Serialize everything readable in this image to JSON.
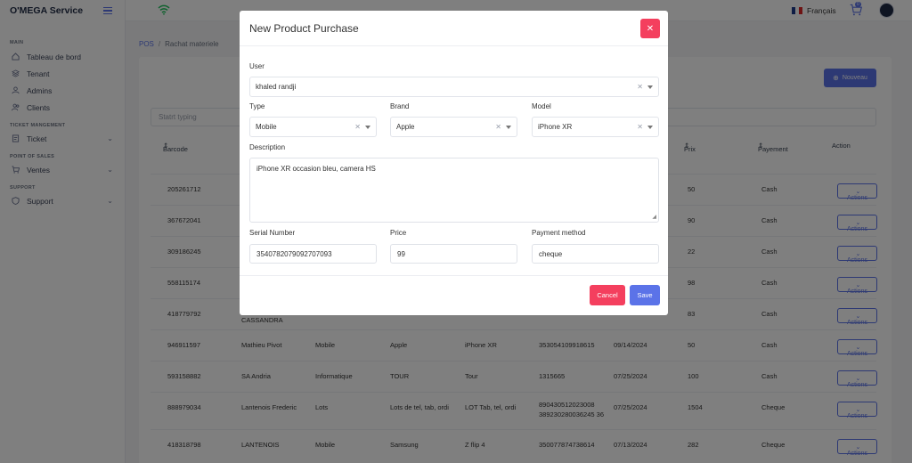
{
  "app": {
    "brand": "O'MEGA Service"
  },
  "sidebar": {
    "sections": [
      {
        "title": "MAIN",
        "items": [
          {
            "label": "Tableau de bord",
            "icon": "home-icon"
          },
          {
            "label": "Tenant",
            "icon": "layers-icon"
          },
          {
            "label": "Admins",
            "icon": "user-icon"
          },
          {
            "label": "Clients",
            "icon": "users-icon"
          }
        ]
      },
      {
        "title": "TICKET MANGEMENT",
        "items": [
          {
            "label": "Ticket",
            "icon": "ticket-icon",
            "expandable": true
          }
        ]
      },
      {
        "title": "POINT OF SALES",
        "items": [
          {
            "label": "Ventes",
            "icon": "cart-icon",
            "expandable": true
          }
        ]
      },
      {
        "title": "SUPPORT",
        "items": [
          {
            "label": "Support",
            "icon": "shield-icon",
            "expandable": true
          }
        ]
      }
    ]
  },
  "topbar": {
    "language": "Français",
    "cart_count": "0"
  },
  "breadcrumb": {
    "root": "POS",
    "separator": "/",
    "current": "Rachat materiele"
  },
  "page": {
    "new_button": "Nouveau",
    "search_placeholder": "Statrt typing",
    "columns": [
      "Barcode",
      "Prix",
      "Payement",
      "Action"
    ],
    "rows": [
      {
        "barcode": "205261712",
        "name": "",
        "type": "",
        "brand": "",
        "model": "",
        "serial": "",
        "date": "",
        "price": "50",
        "payment": "Cash",
        "action": "Actions"
      },
      {
        "barcode": "367672041",
        "name": "",
        "type": "",
        "brand": "",
        "model": "",
        "serial": "",
        "date": "",
        "price": "90",
        "payment": "Cash",
        "action": "Actions"
      },
      {
        "barcode": "309186245",
        "name": "",
        "type": "",
        "brand": "",
        "model": "",
        "serial": "",
        "date": "",
        "price": "22",
        "payment": "Cash",
        "action": "Actions"
      },
      {
        "barcode": "558115174",
        "name": "",
        "type": "",
        "brand": "",
        "model": "",
        "serial": "",
        "date": "",
        "price": "98",
        "payment": "Cash",
        "action": "Actions"
      },
      {
        "barcode": "418779792",
        "name": "CASSANDRA",
        "type": "",
        "brand": "",
        "model": "",
        "serial": "",
        "date": "",
        "price": "83",
        "payment": "Cash",
        "action": "Actions"
      },
      {
        "barcode": "946911597",
        "name": "Mathieu Pivot",
        "type": "Mobile",
        "brand": "Apple",
        "model": "iPhone XR",
        "serial": "353054109918615",
        "date": "09/14/2024",
        "price": "50",
        "payment": "Cash",
        "action": "Actions"
      },
      {
        "barcode": "593158882",
        "name": "SA Andria",
        "type": "Informatique",
        "brand": "TOUR",
        "model": "Tour",
        "serial": "1315665",
        "date": "07/25/2024",
        "price": "100",
        "payment": "Cash",
        "action": "Actions"
      },
      {
        "barcode": "888979034",
        "name": "Lantenois Frederic",
        "type": "Lots",
        "brand": "Lots de tel, tab, ordi",
        "model": "LOT Tab, tel, ordi",
        "serial": "890430512023008 389230280036245 36",
        "date": "07/25/2024",
        "price": "1504",
        "payment": "Cheque",
        "action": "Actions"
      },
      {
        "barcode": "418318798",
        "name": "LANTENOIS",
        "type": "Mobile",
        "brand": "Samsung",
        "model": "Z flip 4",
        "serial": "350077874738614",
        "date": "07/13/2024",
        "price": "282",
        "payment": "Cheque",
        "action": "Actions"
      }
    ]
  },
  "modal": {
    "title": "New Product Purchase",
    "user_label": "User",
    "user_value": "khaled randji",
    "type_label": "Type",
    "type_value": "Mobile",
    "brand_label": "Brand",
    "brand_value": "Apple",
    "model_label": "Model",
    "model_value": "iPhone XR",
    "description_label": "Description",
    "description_value": "iPhone XR occasion bleu, camera HS",
    "serial_label": "Serial Number",
    "serial_value": "3540782079092707093",
    "price_label": "Price",
    "price_value": "99",
    "payment_label": "Payment method",
    "payment_value": "cheque",
    "cancel": "Cancel",
    "save": "Save",
    "close_icon": "close-icon"
  },
  "colors": {
    "primary": "#5b73e8",
    "danger": "#f43f5e",
    "wifi": "#22c55e"
  }
}
